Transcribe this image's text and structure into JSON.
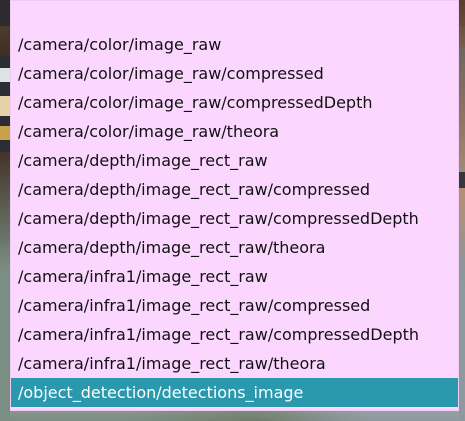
{
  "dropdown": {
    "options": [
      "/camera/color/image_raw",
      "/camera/color/image_raw/compressed",
      "/camera/color/image_raw/compressedDepth",
      "/camera/color/image_raw/theora",
      "/camera/depth/image_rect_raw",
      "/camera/depth/image_rect_raw/compressed",
      "/camera/depth/image_rect_raw/compressedDepth",
      "/camera/depth/image_rect_raw/theora",
      "/camera/infra1/image_rect_raw",
      "/camera/infra1/image_rect_raw/compressed",
      "/camera/infra1/image_rect_raw/compressedDepth",
      "/camera/infra1/image_rect_raw/theora",
      "/object_detection/detections_image"
    ],
    "selected_option": "/object_detection/detections_image"
  },
  "colors": {
    "dropdown_background": "#fbd7ff",
    "selected_background": "#2a98ad",
    "selected_text": "#ffffff",
    "option_text": "#111111"
  }
}
